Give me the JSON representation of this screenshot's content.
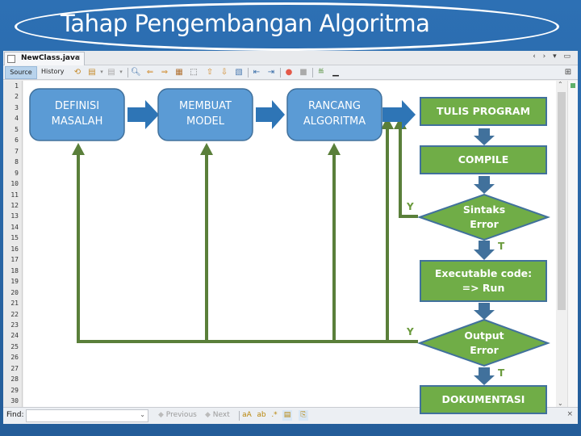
{
  "slide": {
    "title": "Tahap Pengembangan Algoritma",
    "colors": {
      "background": "#2a68a8",
      "process_blue": "#5b9bd5",
      "process_blue_border": "#41719c",
      "arrow_blue": "#2e75b6",
      "process_green": "#70ad47",
      "green_border": "#41719c",
      "line_green": "#5a7f3a",
      "label_green": "#6a9a3c"
    }
  },
  "ide": {
    "file_tab": "NewClass.java",
    "tab_close": "×",
    "window_controls": "‹ › ▾ ▭",
    "toolbar": {
      "source_label": "Source",
      "history_label": "History",
      "icons": [
        "last-edit-icon",
        "back-icon",
        "forward-icon",
        "find-selection-icon",
        "find-previous-icon",
        "find-next-icon",
        "toggle-highlight-icon",
        "rectangular-select-icon",
        "previous-bookmark-icon",
        "next-bookmark-icon",
        "toggle-bookmark-icon",
        "shift-left-icon",
        "shift-right-icon",
        "start-macro-icon",
        "stop-macro-icon",
        "comment-icon",
        "uncomment-icon"
      ]
    },
    "line_numbers": [
      "1",
      "2",
      "3",
      "4",
      "5",
      "6",
      "7",
      "8",
      "9",
      "10",
      "11",
      "12",
      "13",
      "14",
      "15",
      "16",
      "17",
      "18",
      "19",
      "20",
      "21",
      "22",
      "23",
      "24",
      "25",
      "26",
      "27",
      "28",
      "29",
      "30"
    ],
    "findbar": {
      "label": "Find:",
      "input_value": "",
      "previous_label": "Previous",
      "next_label": "Next",
      "close": "×"
    }
  },
  "diagram": {
    "nodes": {
      "definisi": {
        "line1": "DEFINISI",
        "line2": "MASALAH"
      },
      "membuat": {
        "line1": "MEMBUAT",
        "line2": "MODEL"
      },
      "rancang": {
        "line1": "RANCANG",
        "line2": "ALGORITMA"
      },
      "tulis": {
        "label": "TULIS PROGRAM"
      },
      "compile": {
        "label": "COMPILE"
      },
      "sintaks": {
        "line1": "Sintaks",
        "line2": "Error"
      },
      "executable": {
        "line1": "Executable code:",
        "line2": "=> Run"
      },
      "output": {
        "line1": "Output",
        "line2": "Error"
      },
      "dokumentasi": {
        "label": "DOKUMENTASI"
      }
    },
    "labels": {
      "sintaks_yes": "Y",
      "sintaks_no": "T",
      "output_yes": "Y",
      "output_no": "T"
    }
  }
}
